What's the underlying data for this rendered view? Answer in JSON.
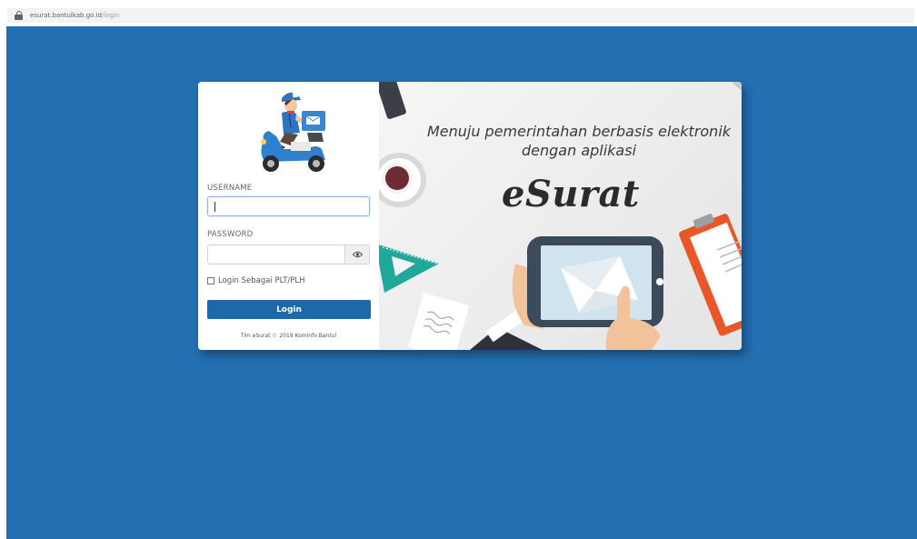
{
  "browser": {
    "url_host": "esurat.bantulkab.go.id",
    "url_path": "/login"
  },
  "login": {
    "username_label": "USERNAME",
    "username_value": "",
    "password_label": "PASSWORD",
    "password_value": "",
    "checkbox_label": "Login Sebagai PLT/PLH",
    "checkbox_checked": false,
    "submit_label": "Login",
    "footer_prefix": "Tim eSurat",
    "footer_copy": "©",
    "footer_suffix": "2019 Kominfo Bantul"
  },
  "hero": {
    "tagline_line1": "Menuju pemerintahan berbasis elektronik",
    "tagline_line2": "dengan aplikasi",
    "brand": "eSurat"
  },
  "colors": {
    "background": "#236fb2",
    "button": "#1e67a9",
    "accent_teal": "#21a89a",
    "accent_orange": "#e8572a"
  },
  "icons": {
    "secure": "lock-icon",
    "password_toggle": "eye-icon",
    "logo": "courier-scooter-logo"
  }
}
